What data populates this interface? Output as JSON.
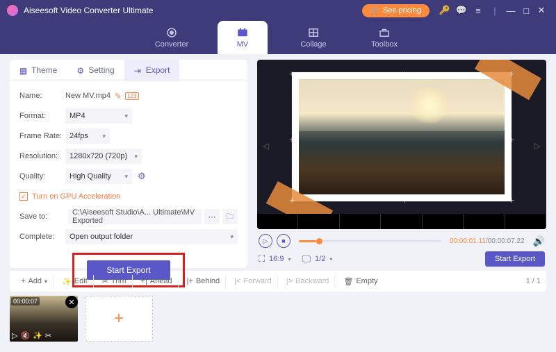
{
  "app_title": "Aiseesoft Video Converter Ultimate",
  "pricing_label": "See pricing",
  "main_tabs": {
    "converter": "Converter",
    "mv": "MV",
    "collage": "Collage",
    "toolbox": "Toolbox"
  },
  "sub_tabs": {
    "theme": "Theme",
    "setting": "Setting",
    "export": "Export"
  },
  "form": {
    "name_label": "Name:",
    "name_value": "New MV.mp4",
    "format_label": "Format:",
    "format_value": "MP4",
    "framerate_label": "Frame Rate:",
    "framerate_value": "24fps",
    "resolution_label": "Resolution:",
    "resolution_value": "1280x720 (720p)",
    "quality_label": "Quality:",
    "quality_value": "High Quality",
    "gpu_label": "Turn on GPU Acceleration",
    "saveto_label": "Save to:",
    "saveto_value": "C:\\Aiseesoft Studio\\A... Ultimate\\MV Exported",
    "complete_label": "Complete:",
    "complete_value": "Open output folder"
  },
  "start_export": "Start Export",
  "player": {
    "time_current": "00:00:01.11",
    "time_total": "00:00:07.22",
    "aspect": "16:9",
    "page": "1/2"
  },
  "start_export2": "Start Export",
  "toolbar": {
    "add": "Add",
    "edit": "Edit",
    "trim": "Trim",
    "ahead": "Ahead",
    "behind": "Behind",
    "forward": "Forward",
    "backward": "Backward",
    "empty": "Empty",
    "page": "1 / 1"
  },
  "clip_time": "00:00:07"
}
